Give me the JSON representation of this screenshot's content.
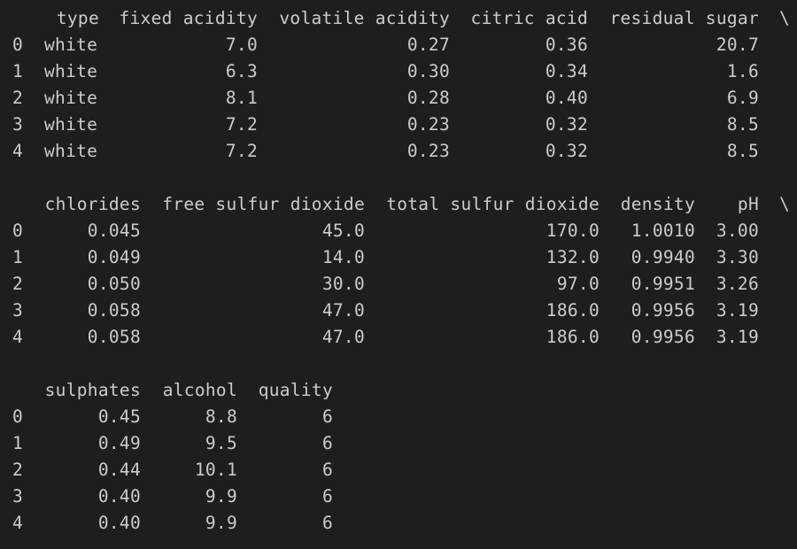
{
  "output": {
    "block1": {
      "headers": [
        "type",
        "fixed acidity",
        "volatile acidity",
        "citric acid",
        "residual sugar"
      ],
      "continuation": "\\",
      "rows": [
        {
          "index": "0",
          "cells": [
            "white",
            "7.0",
            "0.27",
            "0.36",
            "20.7"
          ]
        },
        {
          "index": "1",
          "cells": [
            "white",
            "6.3",
            "0.30",
            "0.34",
            "1.6"
          ]
        },
        {
          "index": "2",
          "cells": [
            "white",
            "8.1",
            "0.28",
            "0.40",
            "6.9"
          ]
        },
        {
          "index": "3",
          "cells": [
            "white",
            "7.2",
            "0.23",
            "0.32",
            "8.5"
          ]
        },
        {
          "index": "4",
          "cells": [
            "white",
            "7.2",
            "0.23",
            "0.32",
            "8.5"
          ]
        }
      ]
    },
    "block2": {
      "headers": [
        "chlorides",
        "free sulfur dioxide",
        "total sulfur dioxide",
        "density",
        "pH"
      ],
      "continuation": "\\",
      "rows": [
        {
          "index": "0",
          "cells": [
            "0.045",
            "45.0",
            "170.0",
            "1.0010",
            "3.00"
          ]
        },
        {
          "index": "1",
          "cells": [
            "0.049",
            "14.0",
            "132.0",
            "0.9940",
            "3.30"
          ]
        },
        {
          "index": "2",
          "cells": [
            "0.050",
            "30.0",
            "97.0",
            "0.9951",
            "3.26"
          ]
        },
        {
          "index": "3",
          "cells": [
            "0.058",
            "47.0",
            "186.0",
            "0.9956",
            "3.19"
          ]
        },
        {
          "index": "4",
          "cells": [
            "0.058",
            "47.0",
            "186.0",
            "0.9956",
            "3.19"
          ]
        }
      ]
    },
    "block3": {
      "headers": [
        "sulphates",
        "alcohol",
        "quality"
      ],
      "rows": [
        {
          "index": "0",
          "cells": [
            "0.45",
            "8.8",
            "6"
          ]
        },
        {
          "index": "1",
          "cells": [
            "0.49",
            "9.5",
            "6"
          ]
        },
        {
          "index": "2",
          "cells": [
            "0.44",
            "10.1",
            "6"
          ]
        },
        {
          "index": "3",
          "cells": [
            "0.40",
            "9.9",
            "6"
          ]
        },
        {
          "index": "4",
          "cells": [
            "0.40",
            "9.9",
            "6"
          ]
        }
      ]
    }
  },
  "theme": {
    "background": "#1e1e1e",
    "text": "#cccccc"
  }
}
